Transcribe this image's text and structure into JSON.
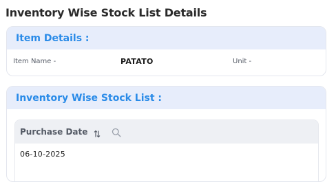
{
  "page": {
    "title": "Inventory Wise Stock List Details"
  },
  "item_details": {
    "header": "Item Details :",
    "item_name_label": "Item Name -",
    "item_name_value": "PATATO",
    "unit_label": "Unit -",
    "unit_value": ""
  },
  "stock_list": {
    "header": "Inventory Wise Stock List :",
    "columns": [
      {
        "label": "Purchase Date",
        "sort_icon": "sort-arrows-icon",
        "filter_icon": "search-icon"
      }
    ],
    "rows": [
      {
        "purchase_date": "06-10-2025"
      }
    ]
  },
  "colors": {
    "accent": "#2a8be8",
    "header_bg": "#e7edfb",
    "table_head_bg": "#eef0f4"
  }
}
